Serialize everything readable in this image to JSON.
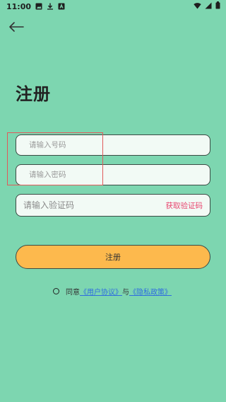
{
  "status_bar": {
    "time": "11:00"
  },
  "header": {
    "title": "注册"
  },
  "form": {
    "phone_placeholder": "请输入号码",
    "password_placeholder": "请输入密码",
    "code_placeholder": "请输入验证码",
    "get_code_label": "获取验证码",
    "submit_label": "注册"
  },
  "agreement": {
    "prefix": "同意",
    "user_agreement": "《用户协议》",
    "conjunction": "与",
    "privacy_policy": "《隐私政策》"
  },
  "colors": {
    "background": "#7dd6b0",
    "button": "#fdb94d",
    "accent_link": "#2f6de0",
    "get_code": "#e8456f",
    "highlight": "#e05a5a"
  }
}
